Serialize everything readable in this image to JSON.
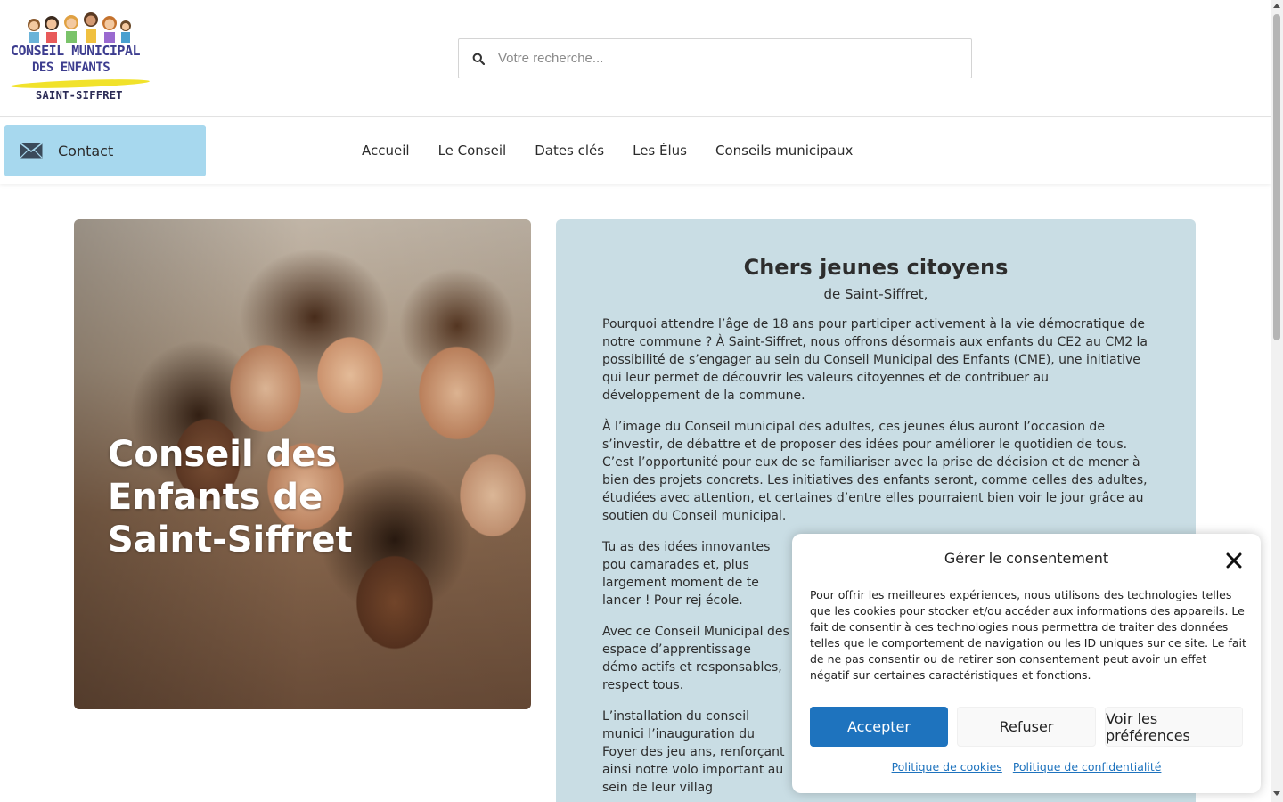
{
  "header": {
    "logo": {
      "line1": "CONSEIL MUNICIPAL",
      "line2": "DES ENFANTS",
      "town": "SAINT-SIFFRET"
    },
    "search": {
      "placeholder": "Votre recherche...",
      "value": ""
    }
  },
  "nav": {
    "contact_label": "Contact",
    "items": [
      {
        "label": "Accueil"
      },
      {
        "label": "Le Conseil"
      },
      {
        "label": "Dates clés"
      },
      {
        "label": "Les Élus"
      },
      {
        "label": "Conseils municipaux"
      }
    ]
  },
  "hero": {
    "title": "Conseil des Enfants de Saint-Siffret"
  },
  "panel": {
    "heading": "Chers jeunes citoyens",
    "subheading": "de Saint-Siffret,",
    "paragraphs": [
      "Pourquoi attendre l’âge de 18 ans pour participer activement à la vie démocratique de notre commune ? À Saint-Siffret, nous offrons désormais aux enfants du CE2 au CM2 la possibilité de s’engager au sein du Conseil Municipal des Enfants (CME), une initiative qui leur permet de découvrir les valeurs citoyennes et de contribuer au développement de la commune.",
      "À l’image du Conseil municipal des adultes, ces jeunes élus auront l’occasion de s’investir, de débattre et de proposer des idées pour améliorer le quotidien de tous. C’est l’opportunité pour eux de se familiariser avec la prise de décision et de mener à bien des projets concrets. Les initiatives des enfants seront, comme celles des adultes, étudiées avec attention, et certaines d’entre elles pourraient bien voir le jour grâce au soutien du Conseil municipal.",
      "Tu as des idées innovantes pou camarades et, plus largement moment de te lancer ! Pour rej école.",
      "Avec ce Conseil Municipal des espace d’apprentissage démo actifs et responsables, respect tous.",
      "L’installation du conseil munici l’inauguration du Foyer des jeu ans, renforçant ainsi notre volo important au sein de leur villag"
    ]
  },
  "consent": {
    "title": "Gérer le consentement",
    "body": "Pour offrir les meilleures expériences, nous utilisons des technologies telles que les cookies pour stocker et/ou accéder aux informations des appareils. Le fait de consentir à ces technologies nous permettra de traiter des données telles que le comportement de navigation ou les ID uniques sur ce site. Le fait de ne pas consentir ou de retirer son consentement peut avoir un effet négatif sur certaines caractéristiques et fonctions.",
    "accept_label": "Accepter",
    "deny_label": "Refuser",
    "prefs_label": "Voir les préférences",
    "cookie_policy_label": "Politique de cookies",
    "privacy_policy_label": "Politique de confidentialité"
  },
  "colors": {
    "contact_bg": "#a7d8ee",
    "panel_bg": "#c9dde4",
    "accept_bg": "#1e73be",
    "logo_yellow": "#f1e22b",
    "logo_text": "#3d3d8f"
  },
  "icons": {
    "search": "search-icon",
    "contact": "envelope-icon",
    "close": "close-icon"
  }
}
